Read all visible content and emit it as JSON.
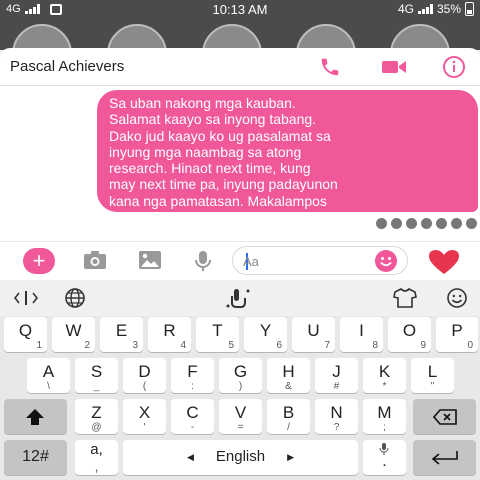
{
  "status_bar": {
    "network": "4G",
    "time": "10:13 AM",
    "network_right": "4G",
    "battery": "35%"
  },
  "chat": {
    "title": "Pascal Achievers",
    "message": "Sa uban nakong mga kauban.\nSalamat kaayo sa inyong tabang.\nDako jud kaayo  ko ug pasalamat sa\ninyung mga naambag sa atong\nresearch. Hinaot next time,  kung\nmay next time pa,  inyung padayunon\nkana nga pamatasan. Makalampos\njud mo ug eskwela ana. Salamat.",
    "composer_placeholder": "Aa"
  },
  "colors": {
    "accent": "#f0589a",
    "heart": "#e8344d",
    "caret": "#2f6ff5"
  },
  "keyboard": {
    "row1": [
      {
        "k": "Q",
        "s": "1"
      },
      {
        "k": "W",
        "s": "2"
      },
      {
        "k": "E",
        "s": "3"
      },
      {
        "k": "R",
        "s": "4"
      },
      {
        "k": "T",
        "s": "5"
      },
      {
        "k": "Y",
        "s": "6"
      },
      {
        "k": "U",
        "s": "7"
      },
      {
        "k": "I",
        "s": "8"
      },
      {
        "k": "O",
        "s": "9"
      },
      {
        "k": "P",
        "s": "0"
      }
    ],
    "row2": [
      {
        "k": "A",
        "s": "\\"
      },
      {
        "k": "S",
        "s": "_"
      },
      {
        "k": "D",
        "s": "("
      },
      {
        "k": "F",
        "s": ":"
      },
      {
        "k": "G",
        "s": ")"
      },
      {
        "k": "H",
        "s": "&"
      },
      {
        "k": "J",
        "s": "#"
      },
      {
        "k": "K",
        "s": "*"
      },
      {
        "k": "L",
        "s": "\""
      }
    ],
    "row3": [
      {
        "k": "Z",
        "s": "@"
      },
      {
        "k": "X",
        "s": "'"
      },
      {
        "k": "C",
        "s": "-"
      },
      {
        "k": "V",
        "s": "="
      },
      {
        "k": "B",
        "s": "/"
      },
      {
        "k": "N",
        "s": "?"
      },
      {
        "k": "M",
        "s": ";"
      }
    ],
    "numbers_label": "12#",
    "comma_main": "a,",
    "comma_sub": ",",
    "space_label": "English",
    "period_label": ".",
    "period_sub": "…"
  }
}
